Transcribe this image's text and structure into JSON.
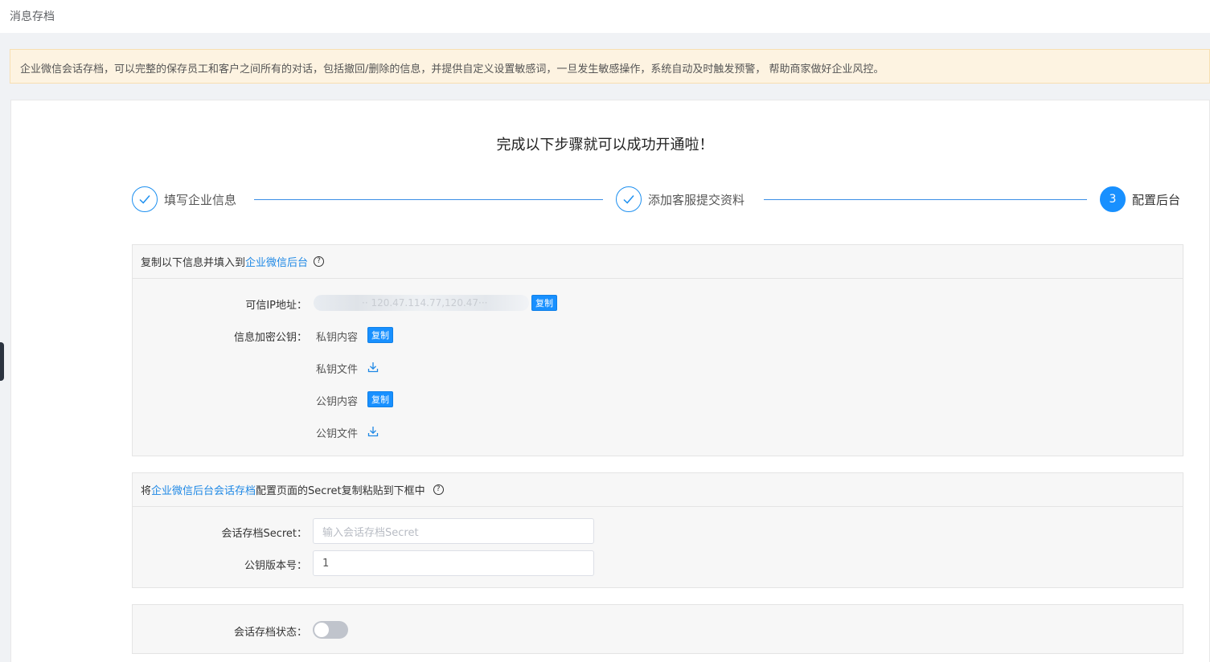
{
  "page": {
    "title": "消息存档",
    "notice": "企业微信会话存档，可以完整的保存员工和客户之间所有的对话，包括撤回/删除的信息，并提供自定义设置敏感词，一旦发生敏感操作，系统自动及时触发预警， 帮助商家做好企业风控。"
  },
  "heading": "完成以下步骤就可以成功开通啦！",
  "steps": [
    {
      "label": "填写企业信息",
      "status": "done"
    },
    {
      "label": "添加客服提交资料",
      "status": "done"
    },
    {
      "label": "配置后台",
      "status": "active",
      "number": "3"
    }
  ],
  "section1": {
    "head_prefix": "复制以下信息并填入到",
    "head_link": "企业微信后台",
    "help": "?",
    "ip_label": "可信IP地址：",
    "ip_value_blurred": "·· 120.47.114.77,120.47···",
    "copy_label": "复制",
    "key_label": "信息加密公钥：",
    "private_content": "私钥内容",
    "private_file": "私钥文件",
    "public_content": "公钥内容",
    "public_file": "公钥文件"
  },
  "section2": {
    "head_prefix": "将",
    "head_link": "企业微信后台会话存档",
    "head_suffix": "配置页面的Secret复制粘贴到下框中",
    "help": "?",
    "secret_label": "会话存档Secret：",
    "secret_placeholder": "输入会话存档Secret",
    "version_label": "公钥版本号：",
    "version_value": "1"
  },
  "section3": {
    "status_label": "会话存档状态：",
    "status_on": false
  },
  "colors": {
    "accent": "#1890ff",
    "notice_bg": "#fdf3e1",
    "link": "#1e88e5"
  }
}
